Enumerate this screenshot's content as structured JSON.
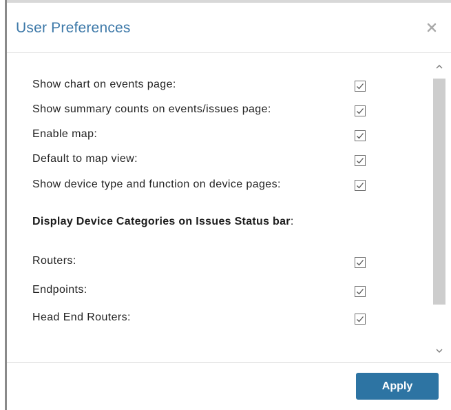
{
  "dialog": {
    "title": "User Preferences",
    "close_icon": "close-icon"
  },
  "preferences": [
    {
      "label": "Show chart on events page:",
      "checked": true
    },
    {
      "label": "Show summary counts on events/issues page:",
      "checked": true
    },
    {
      "label": "Enable map:",
      "checked": true
    },
    {
      "label": "Default to map view:",
      "checked": true
    },
    {
      "label": "Show device type and function on device pages:",
      "checked": true
    }
  ],
  "section": {
    "heading": "Display Device Categories on Issues Status bar",
    "heading_suffix": ":"
  },
  "categories": [
    {
      "label": "Routers:",
      "checked": true
    },
    {
      "label": "Endpoints:",
      "checked": true
    },
    {
      "label": "Head End Routers:",
      "checked": true
    }
  ],
  "scrollbar": {
    "up_icon": "chevron-up-icon",
    "down_icon": "chevron-down-icon"
  },
  "footer": {
    "apply_label": "Apply"
  },
  "colors": {
    "title": "#3c78a8",
    "apply_button": "#2d74a3",
    "scroll_thumb": "#cdcdcd"
  }
}
